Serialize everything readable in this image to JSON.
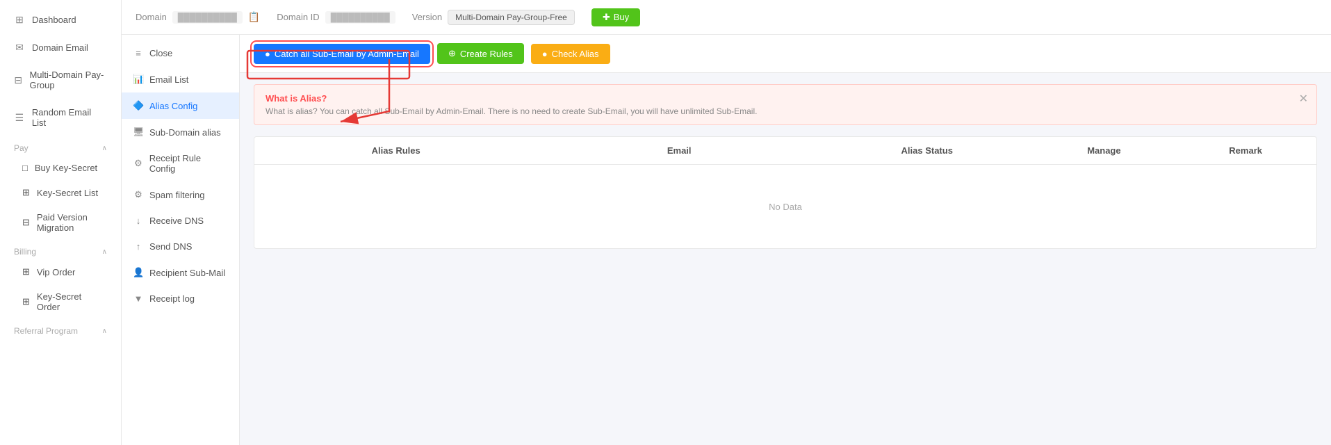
{
  "topbar": {
    "domain_label": "Domain",
    "domain_value": "██████████",
    "domain_id_label": "Domain ID",
    "domain_id_value": "██████████",
    "version_label": "Version",
    "version_badge": "Multi-Domain Pay-Group-Free",
    "buy_btn": "Buy"
  },
  "sidebar": {
    "items": [
      {
        "label": "Dashboard",
        "icon": "⊞"
      },
      {
        "label": "Domain Email",
        "icon": "✉"
      },
      {
        "label": "Multi-Domain Pay-Group",
        "icon": "⊟"
      },
      {
        "label": "Random Email List",
        "icon": "☰"
      }
    ],
    "pay_section": "Pay",
    "pay_items": [
      {
        "label": "Buy Key-Secret",
        "icon": "□"
      },
      {
        "label": "Key-Secret List",
        "icon": "⊞"
      },
      {
        "label": "Paid Version Migration",
        "icon": "⊟"
      }
    ],
    "billing_section": "Billing",
    "billing_items": [
      {
        "label": "Vip Order",
        "icon": "⊞"
      },
      {
        "label": "Key-Secret Order",
        "icon": "⊞"
      }
    ],
    "referral_section": "Referral Program"
  },
  "secondary_nav": {
    "items": [
      {
        "label": "Close",
        "icon": "≡",
        "active": false
      },
      {
        "label": "Email List",
        "icon": "📊",
        "active": false
      },
      {
        "label": "Alias Config",
        "icon": "🔷",
        "active": true
      },
      {
        "label": "Sub-Domain alias",
        "icon": "🖥",
        "active": false
      },
      {
        "label": "Receipt Rule Config",
        "icon": "⚙",
        "active": false
      },
      {
        "label": "Spam filtering",
        "icon": "⚙",
        "active": false
      },
      {
        "label": "Receive DNS",
        "icon": "↓",
        "active": false
      },
      {
        "label": "Send DNS",
        "icon": "↑",
        "active": false
      },
      {
        "label": "Recipient Sub-Mail",
        "icon": "👤",
        "active": false
      },
      {
        "label": "Receipt log",
        "icon": "▼",
        "active": false
      }
    ]
  },
  "action_bar": {
    "catch_btn": "Catch all Sub-Email by Admin-Email",
    "create_btn": "Create Rules",
    "check_btn": "Check Alias"
  },
  "info_banner": {
    "title": "What is Alias?",
    "desc": "What is alias? You can catch all Sub-Email by Admin-Email. There is no need to create Sub-Email, you will have unlimited Sub-Email."
  },
  "table": {
    "headers": [
      "Alias Rules",
      "Email",
      "Alias Status",
      "Manage",
      "Remark"
    ],
    "no_data": "No Data"
  },
  "icons": {
    "bullet": "●",
    "check": "✓",
    "plus": "+"
  }
}
